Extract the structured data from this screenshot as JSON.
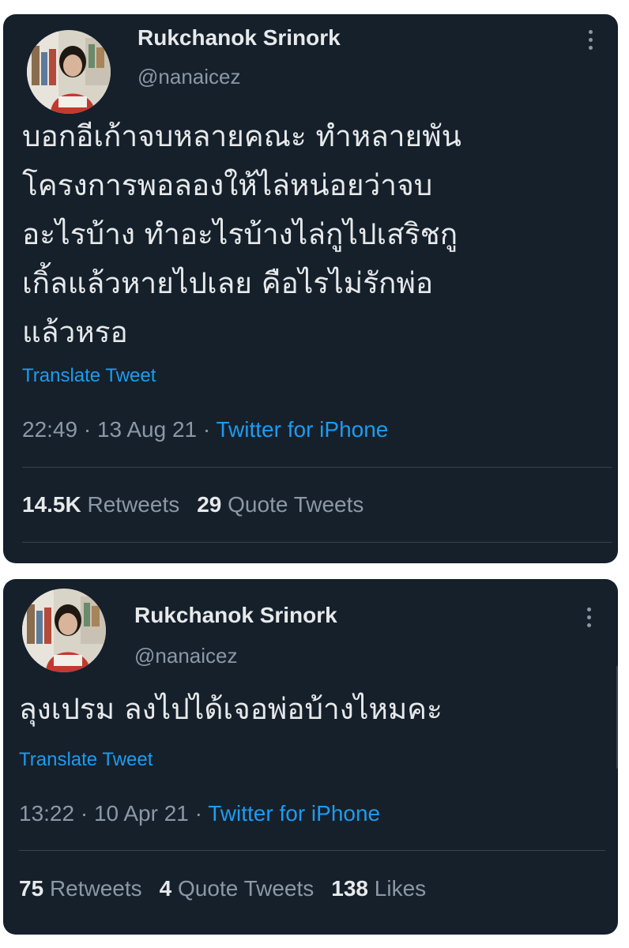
{
  "tweets": [
    {
      "author": {
        "name": "Rukchanok Srinork",
        "handle": "@nanaicez"
      },
      "text": "บอกอีเก้าจบหลายคณะ ทำหลายพัน\nโครงการพอลองให้ไล่หน่อยว่าจบ\nอะไรบ้าง ทำอะไรบ้างไล่กูไปเสริชกู\nเกิ้ลแล้วหายไปเลย คือไรไม่รักพ่อ\nแล้วหรอ",
      "translate_label": "Translate Tweet",
      "time": "22:49",
      "date": "13 Aug 21",
      "separator": " · ",
      "source": "Twitter for iPhone",
      "stats": {
        "retweets_count": "14.5K",
        "retweets_label": "Retweets",
        "quotes_count": "29",
        "quotes_label": "Quote Tweets"
      }
    },
    {
      "author": {
        "name": "Rukchanok Srinork",
        "handle": "@nanaicez"
      },
      "text": "ลุงเปรม ลงไปได้เจอพ่อบ้างไหมคะ",
      "translate_label": "Translate Tweet",
      "time": "13:22",
      "date": "10 Apr 21",
      "separator": " · ",
      "source": "Twitter for iPhone",
      "stats": {
        "retweets_count": "75",
        "retweets_label": "Retweets",
        "quotes_count": "4",
        "quotes_label": "Quote Tweets",
        "likes_count": "138",
        "likes_label": "Likes"
      }
    }
  ],
  "icons": {
    "more": "more-vertical-icon"
  },
  "colors": {
    "background": "#15202b",
    "text_primary": "#e7e9ea",
    "text_secondary": "#8b98a5",
    "accent": "#1d9bf0",
    "divider": "#38444d"
  }
}
